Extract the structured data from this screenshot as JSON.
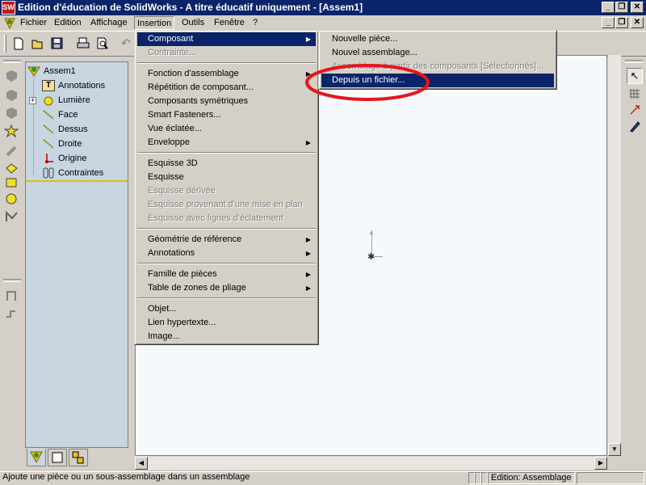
{
  "window": {
    "title": "Edition d'éducation de SolidWorks - A titre éducatif uniquement - [Assem1]"
  },
  "menubar": {
    "items": [
      "Fichier",
      "Edition",
      "Affichage",
      "Insertion",
      "Outils",
      "Fenêtre",
      "?"
    ]
  },
  "tree": {
    "root": "Assem1",
    "items": [
      "Annotations",
      "Lumière",
      "Face",
      "Dessus",
      "Droite",
      "Origine",
      "Contraintes"
    ]
  },
  "insertion_menu": {
    "items": [
      "Composant",
      "Contrainte...",
      "Fonction d'assemblage",
      "Répétition de composant...",
      "Composants symétriques",
      "Smart Fasteners...",
      "Vue éclatée...",
      "Enveloppe",
      "Esquisse 3D",
      "Esquisse",
      "Esquisse dérivée",
      "Esquisse provenant d'une mise en plan",
      "Esquisse avec lignes d'éclatement",
      "Géométrie de référence",
      "Annotations",
      "Famille de pièces",
      "Table de zones de pliage",
      "Objet...",
      "Lien hypertexte...",
      "Image..."
    ]
  },
  "composant_submenu": {
    "items": [
      "Nouvelle pièce...",
      "Nouvel assemblage...",
      "Assemblage à partir des composants [Sélectionnés]...",
      "Depuis un fichier..."
    ]
  },
  "highlight": {
    "color": "#e8141c"
  },
  "statusbar": {
    "message": "Ajoute une pièce ou un sous-assemblage dans un assemblage",
    "mode": "Edition: Assemblage"
  }
}
